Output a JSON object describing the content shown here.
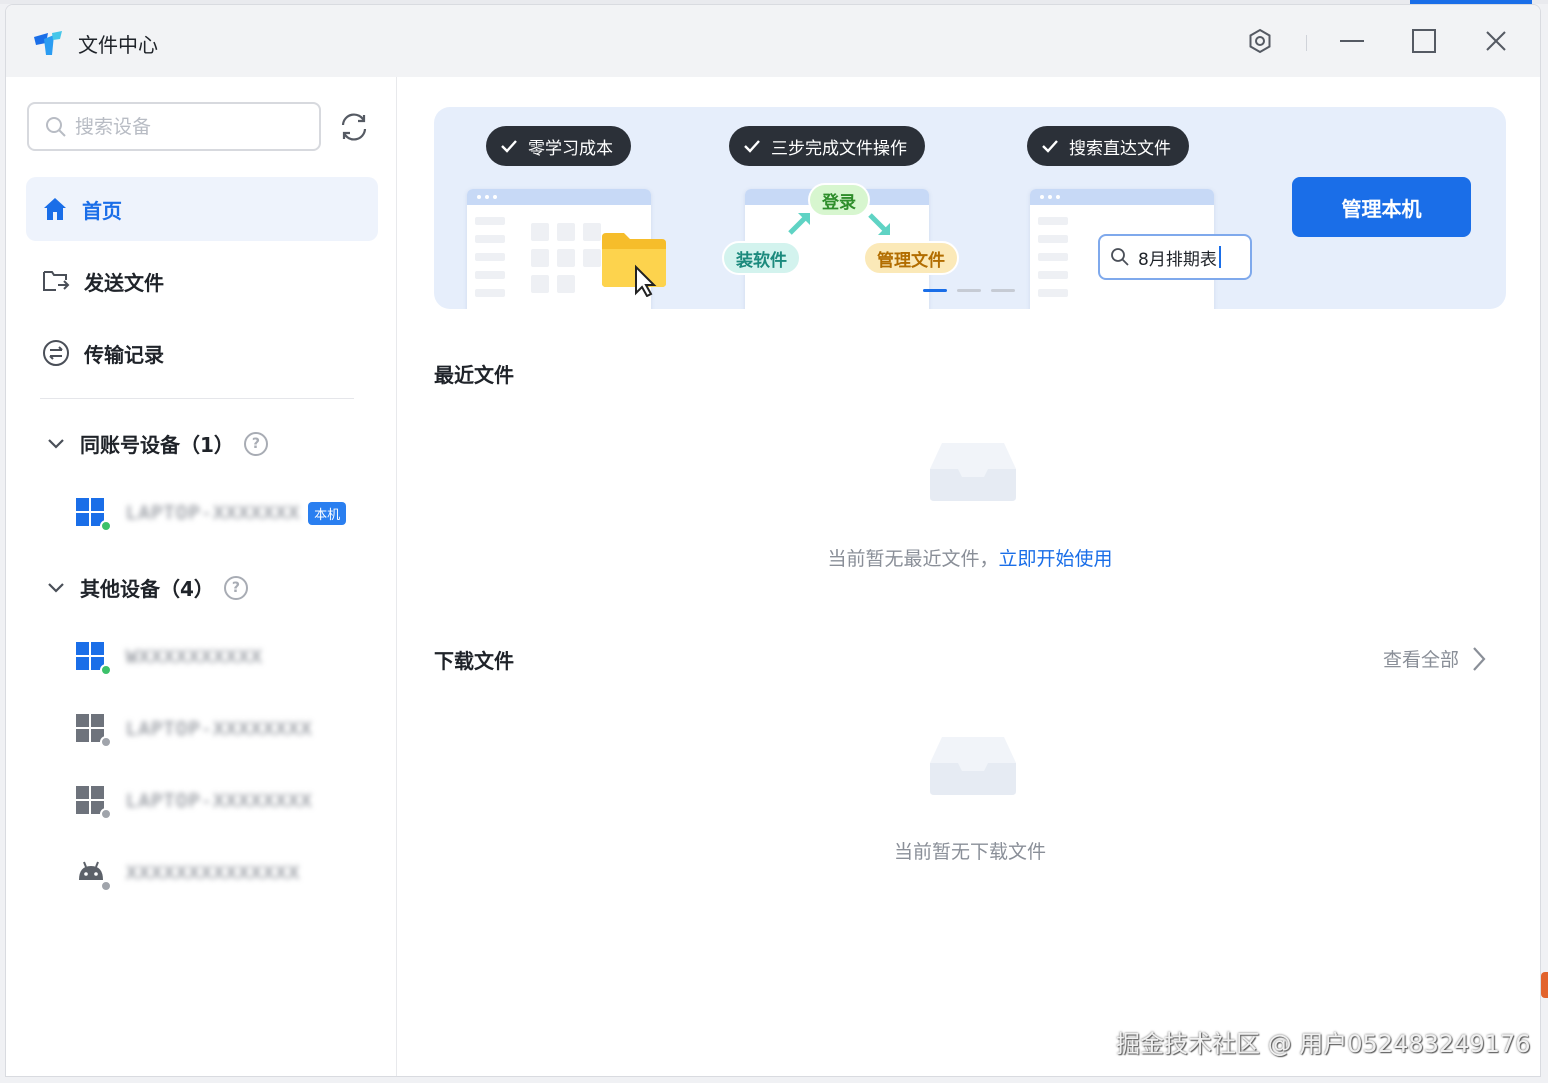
{
  "window": {
    "title": "文件中心"
  },
  "sidebar": {
    "search_placeholder": "搜索设备",
    "nav": [
      {
        "label": "首页",
        "active": true
      },
      {
        "label": "发送文件",
        "active": false
      },
      {
        "label": "传输记录",
        "active": false
      }
    ],
    "groups": [
      {
        "label": "同账号设备（1）",
        "devices": [
          {
            "name": "LAPTOP-XXXXXXX",
            "badge": "本机",
            "icon": "windows-icon",
            "online": true
          }
        ]
      },
      {
        "label": "其他设备（4）",
        "devices": [
          {
            "name": "WXXXXXXXXXX",
            "icon": "windows-icon",
            "online": true
          },
          {
            "name": "LAPTOP-XXXXXXXX",
            "icon": "windows-icon",
            "online": false
          },
          {
            "name": "LAPTOP-XXXXXXXX",
            "icon": "windows-icon",
            "online": false
          },
          {
            "name": "XXXXXXXXXXXXXX",
            "icon": "android-icon",
            "online": false
          }
        ]
      }
    ]
  },
  "banner": {
    "features": [
      "零学习成本",
      "三步完成文件操作",
      "搜索直达文件"
    ],
    "tags": {
      "login": "登录",
      "install": "装软件",
      "manage": "管理文件"
    },
    "search_demo": "8月排期表",
    "manage_button": "管理本机"
  },
  "recent": {
    "title": "最近文件",
    "empty_text": "当前暂无最近文件，",
    "empty_link": "立即开始使用"
  },
  "downloads": {
    "title": "下载文件",
    "view_all": "查看全部",
    "empty_text": "当前暂无下载文件"
  },
  "watermark": "掘金技术社区 @ 用户052483249176",
  "colors": {
    "accent": "#1a6ee8",
    "online": "#3cc16a",
    "offline": "#a0a4ab"
  }
}
